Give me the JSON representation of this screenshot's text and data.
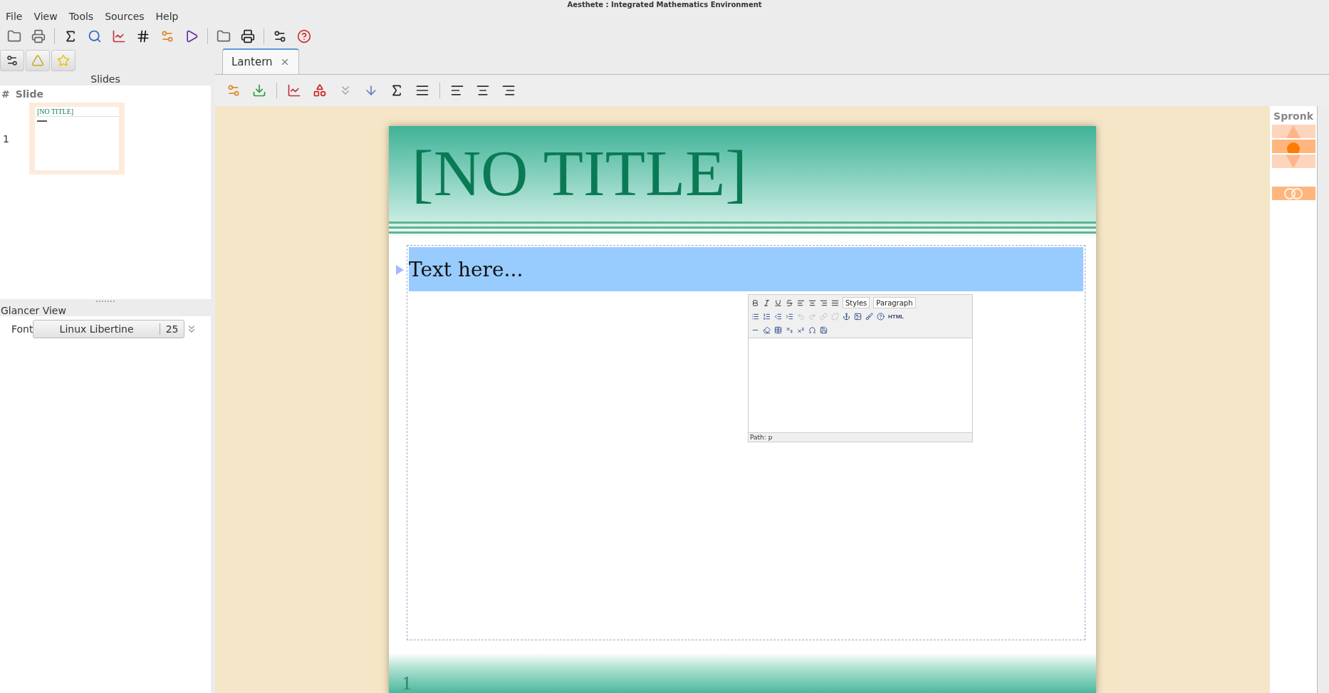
{
  "window": {
    "title": "Aesthete : Integrated Mathematics Environment"
  },
  "menu": [
    "File",
    "View",
    "Tools",
    "Sources",
    "Help"
  ],
  "slides_panel": {
    "title": "Slides",
    "columns": [
      "#",
      "Slide"
    ],
    "slides": [
      {
        "number": "1",
        "thumbnail_title": "[NO TITLE]",
        "selected": true
      }
    ]
  },
  "glancer": {
    "title": "Glancer View",
    "font_label": "Font",
    "font_name": "Linux Libertine",
    "font_size": "25"
  },
  "tabs": [
    {
      "label": "Lantern",
      "selected": true
    }
  ],
  "slide": {
    "title": "[NO TITLE]",
    "body": "Text here...",
    "page_number": "1"
  },
  "rich_editor": {
    "styles": "Styles",
    "format": "Paragraph",
    "html_button": "HTML",
    "path": "Path: p"
  },
  "sidebar": {
    "title": "Spronk"
  }
}
